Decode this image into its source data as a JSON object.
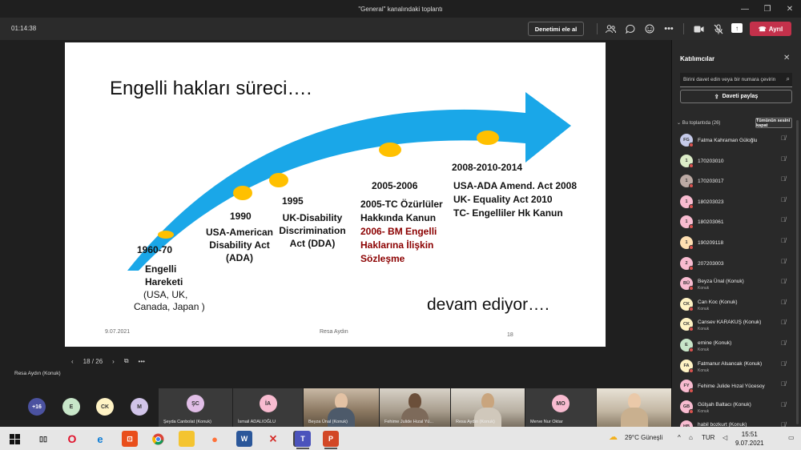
{
  "window": {
    "title": "\"General\" kanalındaki toplantı",
    "controls": [
      "—",
      "❐",
      "✕"
    ]
  },
  "toolbar": {
    "timer": "01:14:38",
    "take_control": "Denetimi ele al",
    "leave": "Ayrıl",
    "icons": [
      "people-icon",
      "chat-icon",
      "reactions-icon",
      "more-icon",
      "camera-icon",
      "mic-off-icon",
      "share-icon"
    ]
  },
  "slide": {
    "title": "Engelli hakları süreci….",
    "footer_date": "9.07.2021",
    "footer_author": "Resa Aydın",
    "footer_page": "18",
    "continues": "devam ediyor….",
    "milestones": {
      "m1960_year": "1960-70",
      "m1960_line1": "Engelli",
      "m1960_line2": "Hareketi",
      "m1960_line3": "(USA, UK,",
      "m1960_line4": "Canada, Japan )",
      "m1990_year": "1990",
      "m1990_line1": "USA-American",
      "m1990_line2": "Disability Act",
      "m1990_line3": "(ADA)",
      "m1995_year": "1995",
      "m1995_line1": "UK-Disability",
      "m1995_line2": "Discrimination",
      "m1995_line3": "Act (DDA)",
      "m2005_year": "2005-2006",
      "m2005_line1": "2005-TC Özürlüler",
      "m2005_line2": "Hakkında Kanun",
      "m2005_red1": "2006- BM Engelli",
      "m2005_red2": "Haklarına İlişkin",
      "m2005_red3": "Sözleşme",
      "m2008_year": "2008-2010-2014",
      "m2008_line1": "USA-ADA Amend. Act 2008",
      "m2008_line2": "UK- Equality Act 2010",
      "m2008_line3": "TC- Engelliler Hk Kanun"
    },
    "colors": {
      "arrow": "#1aa7e8",
      "dot": "#ffc000",
      "red_text": "#8b0000"
    }
  },
  "pager": {
    "prev": "‹",
    "page": "18 / 26",
    "next": "›",
    "more": "•••"
  },
  "presenter": "Resa Aydın (Konuk)",
  "strip": {
    "more_count": "+16",
    "avatars": [
      {
        "initials": "E",
        "color": "#c8e6c9"
      },
      {
        "initials": "CK",
        "color": "#fff3c4"
      },
      {
        "initials": "M",
        "color": "#d1c4e9"
      }
    ],
    "tiles": [
      {
        "initials": "ŞC",
        "name": "Şeyda Canbolat (Konuk)",
        "color": "#e1bee7"
      },
      {
        "initials": "İA",
        "name": "İsmail ADALIOĞLU",
        "color": "#f8bbd0"
      },
      {
        "name": "Beyza Ünal (Konuk)"
      },
      {
        "name": "Fehime Julide Hızal Yü..."
      },
      {
        "name": "Resa Aydın (Konuk)"
      },
      {
        "initials": "MO",
        "name": "Merve Nur Oktar",
        "color": "#f8bbd0"
      },
      {
        "name": ""
      }
    ]
  },
  "panel": {
    "title": "Katılımcılar",
    "search_placeholder": "Birini davet edin veya bir numara çevirin",
    "invite": "Daveti paylaş",
    "group": "Bu toplantıda (26)",
    "mute_all": "Tümünün sesini kapat",
    "participants": [
      {
        "initials": "FG",
        "name": "Fatma Kahraman Güloğlu",
        "sub": "",
        "color": "#c5cae9"
      },
      {
        "initials": "1",
        "name": "170203010",
        "sub": "",
        "color": "#dcedc8"
      },
      {
        "initials": "1",
        "name": "170203017",
        "sub": "",
        "color": "#bcaaa4"
      },
      {
        "initials": "1",
        "name": "180203023",
        "sub": "",
        "color": "#f8bbd0"
      },
      {
        "initials": "1",
        "name": "180203061",
        "sub": "",
        "color": "#f8bbd0"
      },
      {
        "initials": "1",
        "name": "190209118",
        "sub": "",
        "color": "#ffe0b2"
      },
      {
        "initials": "2",
        "name": "207203003",
        "sub": "",
        "color": "#f8bbd0"
      },
      {
        "initials": "BÜ",
        "name": "Beyza Ünal (Konuk)",
        "sub": "Konuk",
        "color": "#f8bbd0"
      },
      {
        "initials": "CK",
        "name": "Can Koc (Konuk)",
        "sub": "Konuk",
        "color": "#fff3c4"
      },
      {
        "initials": "CK",
        "name": "Cansev KARAKUŞ (Konuk)",
        "sub": "Konuk",
        "color": "#fff3c4"
      },
      {
        "initials": "E",
        "name": "emine (Konuk)",
        "sub": "Konuk",
        "color": "#c8e6c9"
      },
      {
        "initials": "FA",
        "name": "Fatmanur Alsancak (Konuk)",
        "sub": "Konuk",
        "color": "#fff3c4"
      },
      {
        "initials": "FY",
        "name": "Fehime Julide Hızal Yücesoy",
        "sub": "",
        "color": "#f8bbd0"
      },
      {
        "initials": "GB",
        "name": "Gülşah Baltacı (Konuk)",
        "sub": "Konuk",
        "color": "#f8bbd0"
      },
      {
        "initials": "HB",
        "name": "habil bozkurt (Konuk)",
        "sub": "Konuk",
        "color": "#f8bbd0"
      }
    ]
  },
  "taskbar": {
    "apps": [
      "start-icon",
      "taskview-icon",
      "opera-icon",
      "edge-icon",
      "office-icon",
      "chrome-icon",
      "explorer-icon",
      "firefox-icon",
      "word-icon",
      "acrobat-icon",
      "sheet-icon",
      "teams-icon",
      "powerpoint-icon"
    ],
    "weather": "29°C  Güneşli",
    "lang": "TUR",
    "time": "15:51",
    "date": "9.07.2021"
  }
}
